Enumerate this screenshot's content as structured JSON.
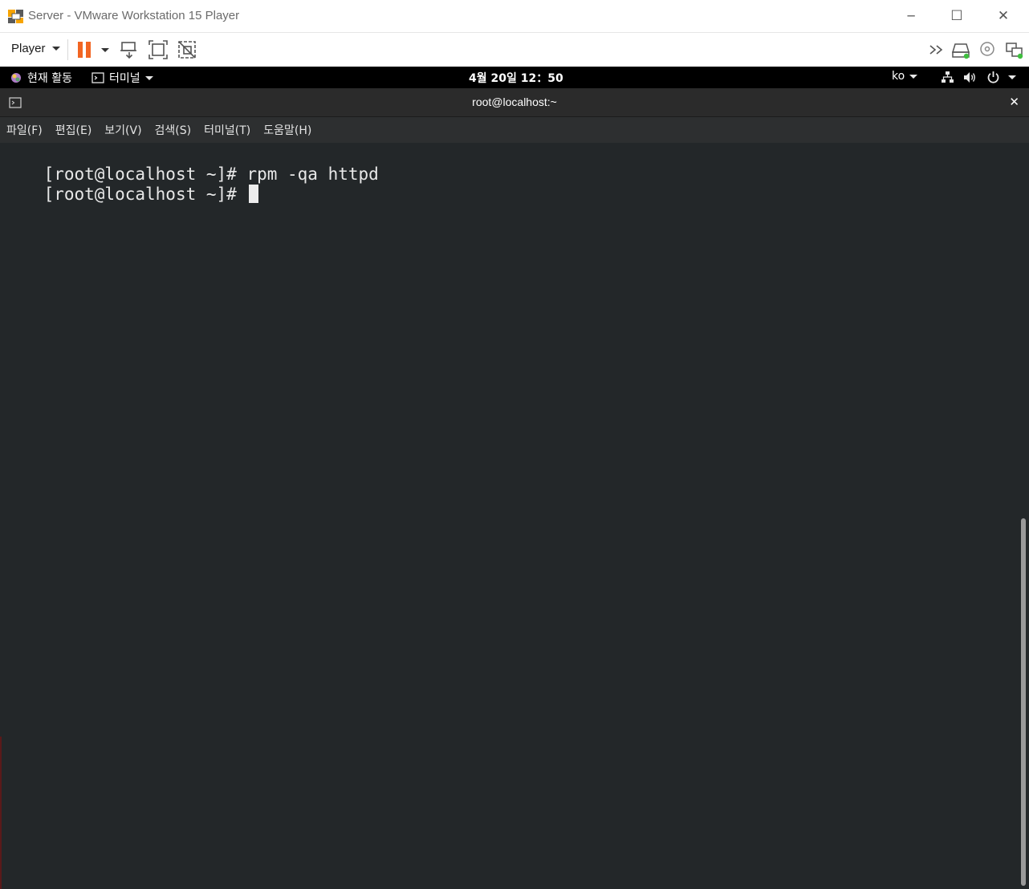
{
  "window": {
    "title": "Server - VMware Workstation 15 Player",
    "minimize_icon": "─",
    "maximize_icon": "☐",
    "close_icon": "✕"
  },
  "toolbar": {
    "player_label": "Player"
  },
  "gnome": {
    "activities_label": "현재 활동",
    "app_label": "터미널",
    "clock": "4월 20일  12：50",
    "input_method": "ko"
  },
  "terminal": {
    "title": "root@localhost:~",
    "close_icon": "✕",
    "menu": [
      "파일(F)",
      "편집(E)",
      "보기(V)",
      "검색(S)",
      "터미널(T)",
      "도움말(H)"
    ],
    "lines": [
      "[root@localhost ~]# rpm -qa httpd",
      "[root@localhost ~]# "
    ]
  },
  "colors": {
    "pause_accent": "#f26522",
    "gnome_bar": "#000000",
    "terminal_bg": "#232729",
    "status_green": "#3fbf3f"
  }
}
